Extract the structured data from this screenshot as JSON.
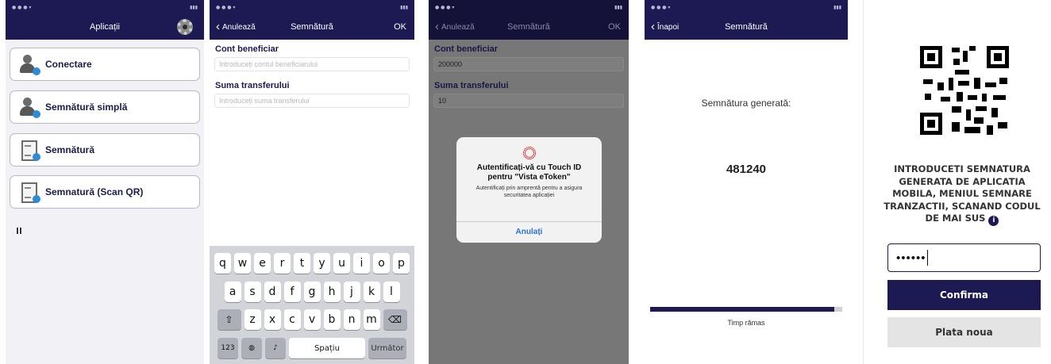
{
  "colors": {
    "navy": "#1c1953",
    "background": "#f1f1f6",
    "link": "#2b73d6"
  },
  "screen1": {
    "title": "Aplicații",
    "menu": [
      {
        "label": "Conectare",
        "icon": "person-key-icon"
      },
      {
        "label": "Semnătură simplă",
        "icon": "person-key-icon"
      },
      {
        "label": "Semnătură",
        "icon": "document-key-icon"
      },
      {
        "label": "Semnatură (Scan QR)",
        "icon": "document-qr-icon"
      }
    ]
  },
  "screen2": {
    "nav": {
      "back": "Anulează",
      "title": "Semnătură",
      "ok": "OK"
    },
    "account_label": "Cont beneficiar",
    "account_placeholder": "Introduceți contul beneficiarului",
    "amount_label": "Suma transferului",
    "amount_placeholder": "Introduceți suma transferului",
    "keyboard": {
      "row1": [
        "q",
        "w",
        "e",
        "r",
        "t",
        "y",
        "u",
        "i",
        "o",
        "p"
      ],
      "row2": [
        "a",
        "s",
        "d",
        "f",
        "g",
        "h",
        "j",
        "k",
        "l"
      ],
      "row3": [
        "z",
        "x",
        "c",
        "v",
        "b",
        "n",
        "m"
      ],
      "numbers": "123",
      "space": "Spațiu",
      "next": "Următor"
    }
  },
  "screen3": {
    "nav": {
      "back": "Anulează",
      "title": "Semnătură",
      "ok": "OK"
    },
    "account_label": "Cont beneficiar",
    "account_value": "200000",
    "amount_label": "Suma transferului",
    "amount_value": "10",
    "alert": {
      "title": "Autentificați-vă cu Touch ID pentru \"Vista eToken\"",
      "message": "Autentificați prin amprentă pentru a asigura securitatea aplicației",
      "button": "Anulați"
    }
  },
  "screen4": {
    "nav": {
      "back": "Înapoi",
      "title": "Semnătură"
    },
    "generated_label": "Semnătura generată:",
    "code": "481240",
    "timer_label": "Timp rămas",
    "timer_fraction": 0.96
  },
  "screen5": {
    "instructions": "INTRODUCETI SEMNATURA GENERATA DE APLICATIA MOBILA, MENIUL SEMNARE TRANZACTII, SCANAND CODUL DE MAI SUS",
    "password_mask": "••••••",
    "confirm": "Confirma",
    "new_payment": "Plata noua"
  }
}
